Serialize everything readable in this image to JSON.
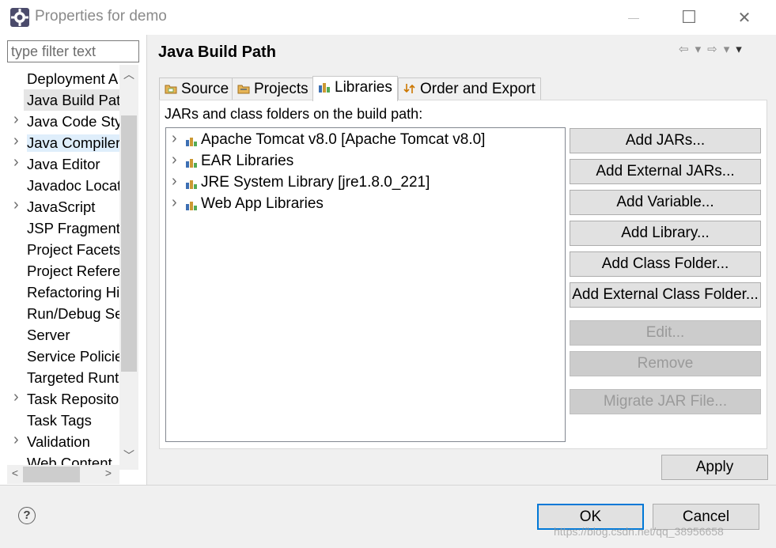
{
  "window": {
    "title": "Properties for demo",
    "minimize_glyph": "—",
    "maximize_glyph": "☐",
    "close_glyph": "✕"
  },
  "left": {
    "filter_placeholder": "type filter text",
    "items": [
      {
        "label": "Deployment A",
        "expandable": false
      },
      {
        "label": "Java Build Path",
        "expandable": false,
        "selected": true
      },
      {
        "label": "Java Code Style",
        "expandable": true
      },
      {
        "label": "Java Compiler",
        "expandable": true,
        "hovered": true
      },
      {
        "label": "Java Editor",
        "expandable": true
      },
      {
        "label": "Javadoc Location",
        "expandable": false
      },
      {
        "label": "JavaScript",
        "expandable": true
      },
      {
        "label": "JSP Fragment",
        "expandable": false
      },
      {
        "label": "Project Facets",
        "expandable": false
      },
      {
        "label": "Project References",
        "expandable": false
      },
      {
        "label": "Refactoring History",
        "expandable": false
      },
      {
        "label": "Run/Debug Settings",
        "expandable": false
      },
      {
        "label": "Server",
        "expandable": false
      },
      {
        "label": "Service Policies",
        "expandable": false
      },
      {
        "label": "Targeted Runtimes",
        "expandable": false
      },
      {
        "label": "Task Repository",
        "expandable": true
      },
      {
        "label": "Task Tags",
        "expandable": false
      },
      {
        "label": "Validation",
        "expandable": true
      },
      {
        "label": "Web Content",
        "expandable": false
      }
    ]
  },
  "main": {
    "title": "Java Build Path",
    "tabs": [
      {
        "label": "Source",
        "icon": "source-folder-icon"
      },
      {
        "label": "Projects",
        "icon": "projects-icon"
      },
      {
        "label": "Libraries",
        "icon": "libraries-icon",
        "active": true
      },
      {
        "label": "Order and Export",
        "icon": "order-export-icon"
      }
    ],
    "section_label": "JARs and class folders on the build path:",
    "libraries": [
      {
        "label": "Apache Tomcat v8.0 [Apache Tomcat v8.0]"
      },
      {
        "label": "EAR Libraries"
      },
      {
        "label": "JRE System Library [jre1.8.0_221]"
      },
      {
        "label": "Web App Libraries"
      }
    ],
    "buttons": [
      {
        "label": "Add JARs...",
        "enabled": true
      },
      {
        "label": "Add External JARs...",
        "enabled": true
      },
      {
        "label": "Add Variable...",
        "enabled": true
      },
      {
        "label": "Add Library...",
        "enabled": true
      },
      {
        "label": "Add Class Folder...",
        "enabled": true
      },
      {
        "label": "Add External Class Folder...",
        "enabled": true
      },
      {
        "label": "Edit...",
        "enabled": false
      },
      {
        "label": "Remove",
        "enabled": false
      },
      {
        "label": "Migrate JAR File...",
        "enabled": false
      }
    ],
    "apply_label": "Apply"
  },
  "footer": {
    "help_glyph": "?",
    "ok_label": "OK",
    "cancel_label": "Cancel",
    "watermark": "https://blog.csdn.net/qq_38956658"
  },
  "colors": {
    "focus_border": "#0078d7",
    "selected_bg": "#e5e5e5",
    "hover_bg": "#dfeefb"
  }
}
